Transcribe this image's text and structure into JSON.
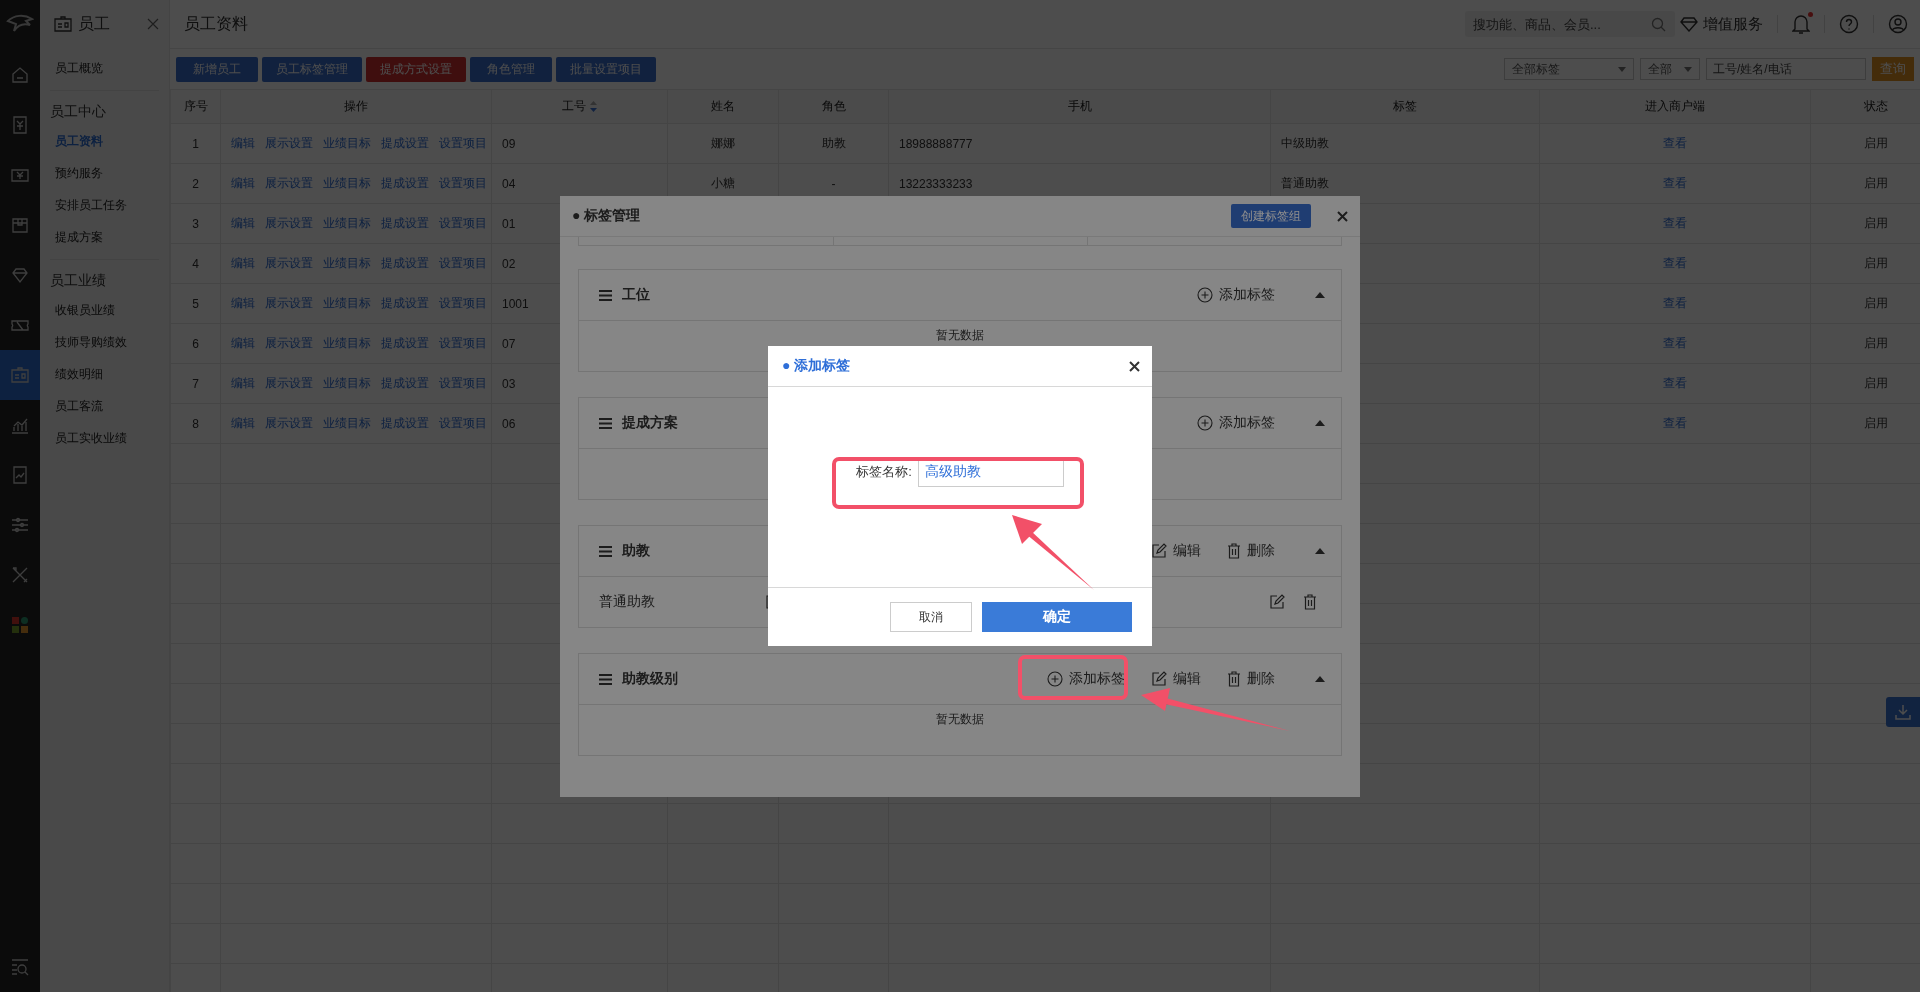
{
  "rail": {
    "items": [
      {
        "selected": false
      },
      {
        "selected": false
      },
      {
        "selected": false
      },
      {
        "selected": false
      },
      {
        "selected": false
      },
      {
        "selected": false
      },
      {
        "selected": true
      },
      {
        "selected": false
      },
      {
        "selected": false
      },
      {
        "selected": false
      },
      {
        "selected": false
      },
      {
        "selected": false
      }
    ]
  },
  "sidebar": {
    "title": "员工",
    "groups": [
      {
        "items": [
          {
            "label": "员工概览",
            "selected": false
          }
        ]
      },
      {
        "heading": "员工中心",
        "items": [
          {
            "label": "员工资料",
            "selected": true
          },
          {
            "label": "预约服务",
            "selected": false
          },
          {
            "label": "安排员工任务",
            "selected": false
          },
          {
            "label": "提成方案",
            "selected": false
          }
        ]
      },
      {
        "heading": "员工业绩",
        "items": [
          {
            "label": "收银员业绩",
            "selected": false
          },
          {
            "label": "技师导购绩效",
            "selected": false
          },
          {
            "label": "绩效明细",
            "selected": false
          },
          {
            "label": "员工客流",
            "selected": false
          },
          {
            "label": "员工实收业绩",
            "selected": false
          }
        ]
      }
    ]
  },
  "header": {
    "title": "员工资料",
    "search_placeholder": "搜功能、商品、会员...",
    "service_label": "增值服务",
    "has_notification": true
  },
  "toolbar": [
    {
      "label": "新增员工",
      "kind": "primary"
    },
    {
      "label": "员工标签管理",
      "kind": "primary"
    },
    {
      "label": "提成方式设置",
      "kind": "danger"
    },
    {
      "label": "角色管理",
      "kind": "primary"
    },
    {
      "label": "批量设置项目",
      "kind": "primary"
    }
  ],
  "filters": {
    "tag": "全部标签",
    "status": "全部",
    "keyword_placeholder": "工号/姓名/电话",
    "query": "查询"
  },
  "table": {
    "columns": [
      {
        "label": "序号",
        "sortable": false
      },
      {
        "label": "操作",
        "sortable": false
      },
      {
        "label": "工号",
        "sortable": true
      },
      {
        "label": "姓名",
        "sortable": false
      },
      {
        "label": "角色",
        "sortable": false
      },
      {
        "label": "手机",
        "sortable": false
      },
      {
        "label": "标签",
        "sortable": false
      },
      {
        "label": "进入商户端",
        "sortable": false
      },
      {
        "label": "状态",
        "sortable": false
      }
    ],
    "rows": [
      {
        "no": "1",
        "actions": [
          "编辑",
          "展示设置",
          "业绩目标",
          "提成设置",
          "设置项目"
        ],
        "staff_no": "09",
        "name": "娜娜",
        "role": "助教",
        "phone": "18988888777",
        "tag": "中级助教",
        "portal": "查看",
        "status": "启用"
      },
      {
        "no": "2",
        "actions": [
          "编辑",
          "展示设置",
          "业绩目标",
          "提成设置",
          "设置项目"
        ],
        "staff_no": "04",
        "name": "小糖",
        "role": "-",
        "phone": "13223333233",
        "tag": "普通助教",
        "portal": "查看",
        "status": "启用"
      },
      {
        "no": "3",
        "actions": [
          "编辑",
          "展示设置",
          "业绩目标",
          "提成设置",
          "设置项目"
        ],
        "staff_no": "01",
        "portal": "查看",
        "status": "启用"
      },
      {
        "no": "4",
        "actions": [
          "编辑",
          "展示设置",
          "业绩目标",
          "提成设置",
          "设置项目"
        ],
        "staff_no": "02",
        "portal": "查看",
        "status": "启用"
      },
      {
        "no": "5",
        "actions": [
          "编辑",
          "展示设置",
          "业绩目标",
          "提成设置",
          "设置项目"
        ],
        "staff_no": "1001",
        "portal": "查看",
        "status": "启用"
      },
      {
        "no": "6",
        "actions": [
          "编辑",
          "展示设置",
          "业绩目标",
          "提成设置",
          "设置项目"
        ],
        "staff_no": "07",
        "portal": "查看",
        "status": "启用"
      },
      {
        "no": "7",
        "actions": [
          "编辑",
          "展示设置",
          "业绩目标",
          "提成设置",
          "设置项目"
        ],
        "staff_no": "03",
        "portal": "查看",
        "status": "启用"
      },
      {
        "no": "8",
        "actions": [
          "编辑",
          "展示设置",
          "业绩目标",
          "提成设置",
          "设置项目"
        ],
        "staff_no": "06",
        "portal": "查看",
        "status": "启用"
      }
    ]
  },
  "tag_manager": {
    "title": "● 标签管理",
    "create_label": "创建标签组",
    "groups": [
      {
        "name": "工位",
        "add_label": "添加标签",
        "expanded": true,
        "empty_text": "暂无数据"
      },
      {
        "name": "提成方案",
        "add_label": "添加标签",
        "expanded": true
      },
      {
        "name": "助教",
        "edit_label": "编辑",
        "delete_label": "删除",
        "expanded": true,
        "tags": [
          {
            "name": "普通助教"
          }
        ]
      },
      {
        "name": "助教级别",
        "add_label": "添加标签",
        "edit_label": "编辑",
        "delete_label": "删除",
        "expanded": true,
        "empty_text": "暂无数据"
      }
    ]
  },
  "add_tag_dialog": {
    "title": "● 添加标签",
    "field_label": "标签名称:",
    "field_value": "高级助教",
    "cancel": "取消",
    "confirm": "确定"
  }
}
